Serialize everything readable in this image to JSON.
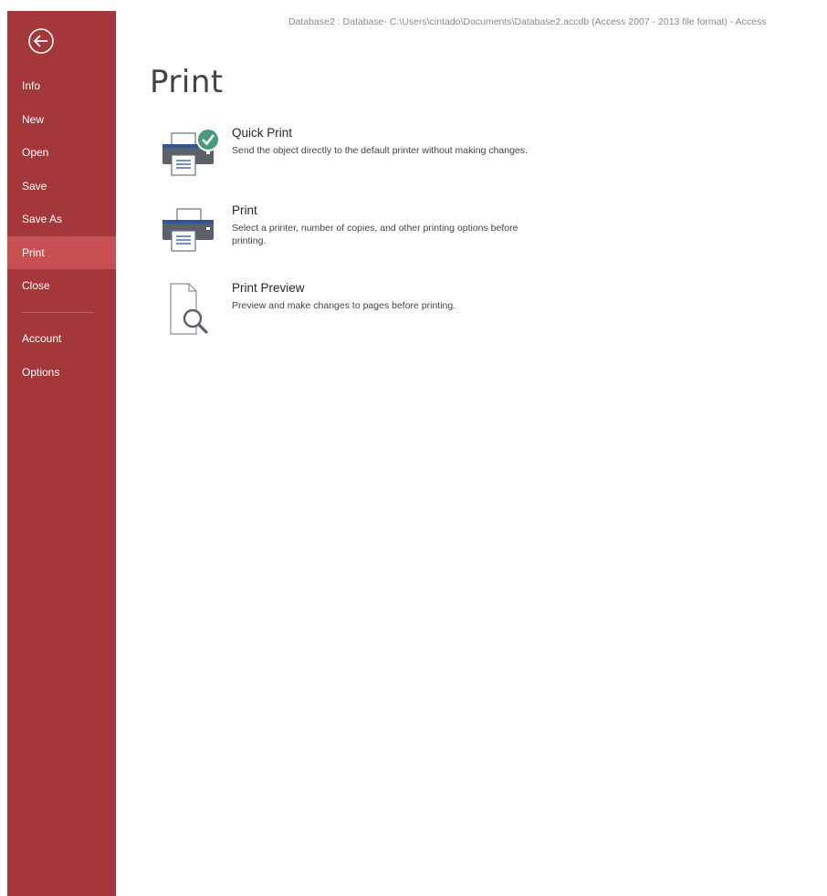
{
  "window": {
    "title": "Database2 : Database- C:\\Users\\cintado\\Documents\\Database2.accdb (Access 2007 - 2013 file format) - Access"
  },
  "sidebar": {
    "background_color": "#a4373a",
    "selected_color": "#c75052",
    "back_icon": "back-arrow-circle-icon",
    "items": [
      {
        "label": "Info",
        "selected": false
      },
      {
        "label": "New",
        "selected": false
      },
      {
        "label": "Open",
        "selected": false
      },
      {
        "label": "Save",
        "selected": false
      },
      {
        "label": "Save As",
        "selected": false
      },
      {
        "label": "Print",
        "selected": true
      },
      {
        "label": "Close",
        "selected": false
      }
    ],
    "secondary_items": [
      {
        "label": "Account"
      },
      {
        "label": "Options"
      }
    ]
  },
  "main": {
    "heading": "Print",
    "options": [
      {
        "title": "Quick Print",
        "description": "Send the object directly to the default printer without making changes.",
        "icon": "printer-check-icon"
      },
      {
        "title": "Print",
        "description": "Select a printer, number of copies, and other printing options before printing.",
        "icon": "printer-icon"
      },
      {
        "title": "Print Preview",
        "description": "Preview and make changes to pages before printing.",
        "icon": "page-magnifier-icon"
      }
    ]
  },
  "colors": {
    "check_badge": "#4a9a7b",
    "printer_body": "#5a6169",
    "printer_accent": "#2b5797"
  }
}
